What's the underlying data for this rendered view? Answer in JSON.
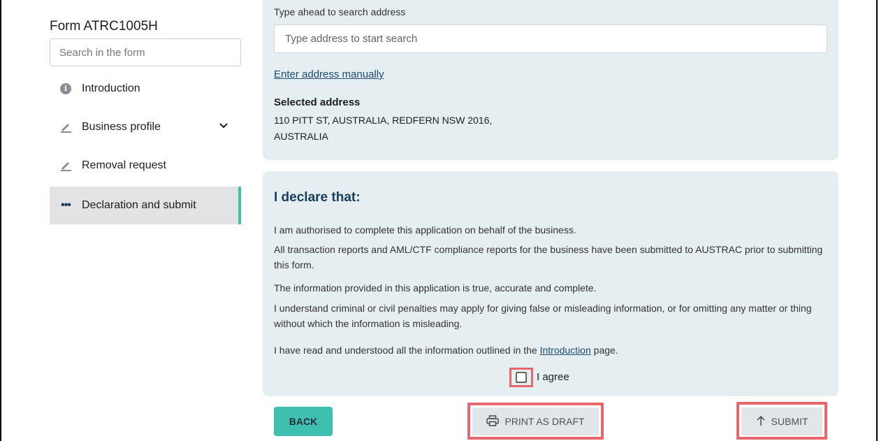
{
  "sidebar": {
    "form_title": "Form ATRC1005H",
    "search_placeholder": "Search in the form",
    "items": [
      {
        "label": "Introduction",
        "icon": "info-icon"
      },
      {
        "label": "Business profile",
        "icon": "pencil-icon",
        "expandable": true
      },
      {
        "label": "Removal request",
        "icon": "pencil-icon"
      },
      {
        "label": "Declaration and submit",
        "icon": "more-dots-icon",
        "active": true
      }
    ]
  },
  "address": {
    "search_label": "Type ahead to search address",
    "search_placeholder": "Type address to start search",
    "manual_link": "Enter address manually",
    "selected_heading": "Selected address",
    "selected_line1": "110 PITT ST, AUSTRALIA, REDFERN NSW 2016,",
    "selected_line2": "AUSTRALIA"
  },
  "declaration": {
    "heading": "I declare that:",
    "statements": [
      "I am authorised to complete this application on behalf of the business.",
      "All transaction reports and AML/CTF compliance reports for the business have been submitted to AUSTRAC prior to submitting this form.",
      "The information provided in this application is true, accurate and complete.",
      "I understand criminal or civil penalties may apply for giving false or misleading information, or for omitting any matter or thing without which the information is misleading."
    ],
    "last_prefix": "I have read and understood all the information outlined in the ",
    "last_link": "Introduction",
    "last_suffix": " page.",
    "agree_label": "I agree",
    "agree_checked": false
  },
  "actions": {
    "back": "BACK",
    "print_draft": "PRINT AS DRAFT",
    "submit": "SUBMIT"
  },
  "colors": {
    "accent": "#3fbfb0",
    "panel_bg": "#e5eef0",
    "highlight": "#e8676e",
    "heading": "#1a3d5c"
  }
}
